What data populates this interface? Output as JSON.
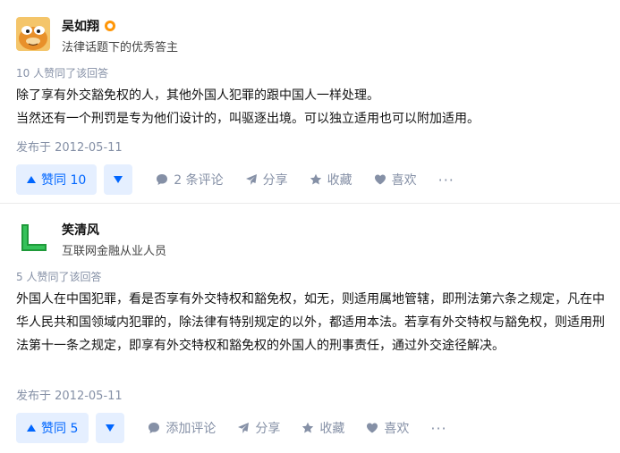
{
  "answers": [
    {
      "author": "吴如翔",
      "headline": "法律话题下的优秀答主",
      "vote_summary": "10 人赞同了该回答",
      "content": [
        "除了享有外交豁免权的人，其他外国人犯罪的跟中国人一样处理。",
        "当然还有一个刑罚是专为他们设计的，叫驱逐出境。可以独立适用也可以附加适用。"
      ],
      "date": "发布于 2012-05-11",
      "vote_label": "赞同 10",
      "comment_label": "2 条评论",
      "share_label": "分享",
      "collect_label": "收藏",
      "like_label": "喜欢",
      "more_label": "···"
    },
    {
      "author": "笑清风",
      "headline": "互联网金融从业人员",
      "vote_summary": "5 人赞同了该回答",
      "content": [
        "外国人在中国犯罪，看是否享有外交特权和豁免权，如无，则适用属地管辖，即刑法第六条之规定，凡在中华人民共和国领域内犯罪的，除法律有特别规定的以外，都适用本法。若享有外交特权与豁免权，则适用刑法第十一条之规定，即享有外交特权和豁免权的外国人的刑事责任，通过外交途径解决。"
      ],
      "date": "发布于 2012-05-11",
      "vote_label": "赞同 5",
      "comment_label": "添加评论",
      "share_label": "分享",
      "collect_label": "收藏",
      "like_label": "喜欢",
      "more_label": "···"
    }
  ],
  "icons": {
    "badge": "star-badge-icon",
    "comment": "comment-icon",
    "share": "share-icon",
    "collect": "star-icon",
    "like": "heart-icon",
    "vote_up": "triangle-up-icon",
    "vote_down": "triangle-down-icon"
  },
  "colors": {
    "accent": "#0066ff",
    "vote_bg": "#e5efff",
    "meta": "#8590a6",
    "badge": "#ff9607"
  }
}
